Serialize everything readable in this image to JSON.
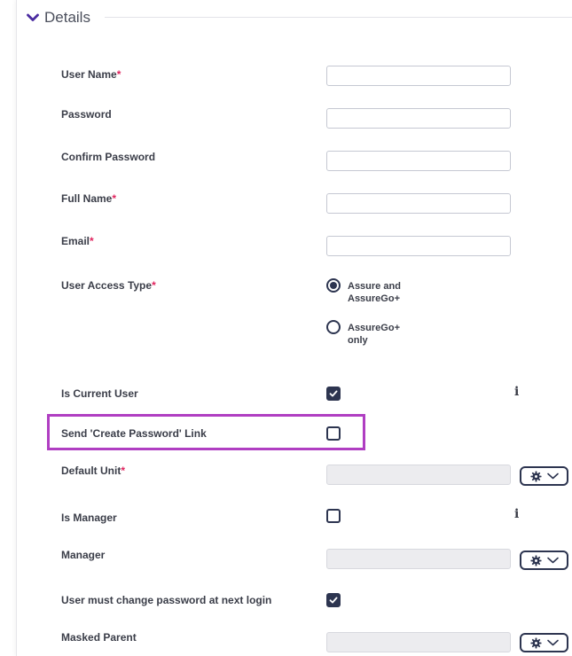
{
  "section": {
    "title": "Details"
  },
  "fields": {
    "user_name": {
      "label": "User Name",
      "required": "*",
      "value": ""
    },
    "password": {
      "label": "Password",
      "value": ""
    },
    "confirm_password": {
      "label": "Confirm Password",
      "value": ""
    },
    "full_name": {
      "label": "Full Name",
      "required": "*",
      "value": ""
    },
    "email": {
      "label": "Email",
      "required": "*",
      "value": ""
    },
    "user_access_type": {
      "label": "User Access Type",
      "required": "*",
      "options": [
        {
          "label_line1": "Assure and",
          "label_line2": "AssureGo+",
          "selected": true
        },
        {
          "label_line1": "AssureGo+",
          "label_line2": "only",
          "selected": false
        }
      ]
    },
    "is_current_user": {
      "label": "Is Current User",
      "checked": true
    },
    "send_create_password_link": {
      "label": "Send 'Create Password' Link",
      "checked": false
    },
    "default_unit": {
      "label": "Default Unit",
      "required": "*",
      "value": ""
    },
    "is_manager": {
      "label": "Is Manager",
      "checked": false
    },
    "manager": {
      "label": "Manager",
      "value": ""
    },
    "must_change_password": {
      "label": "User must change password at next login",
      "checked": true
    },
    "masked_parent": {
      "label": "Masked Parent",
      "value": ""
    }
  },
  "icons": {
    "info": "i",
    "gear": "gear-icon",
    "chevron": "chevron-down-icon"
  },
  "colors": {
    "accent": "#2d3550",
    "required": "#e0245e",
    "highlight": "#b03ec2",
    "legend_chevron": "#4a2ba0"
  }
}
